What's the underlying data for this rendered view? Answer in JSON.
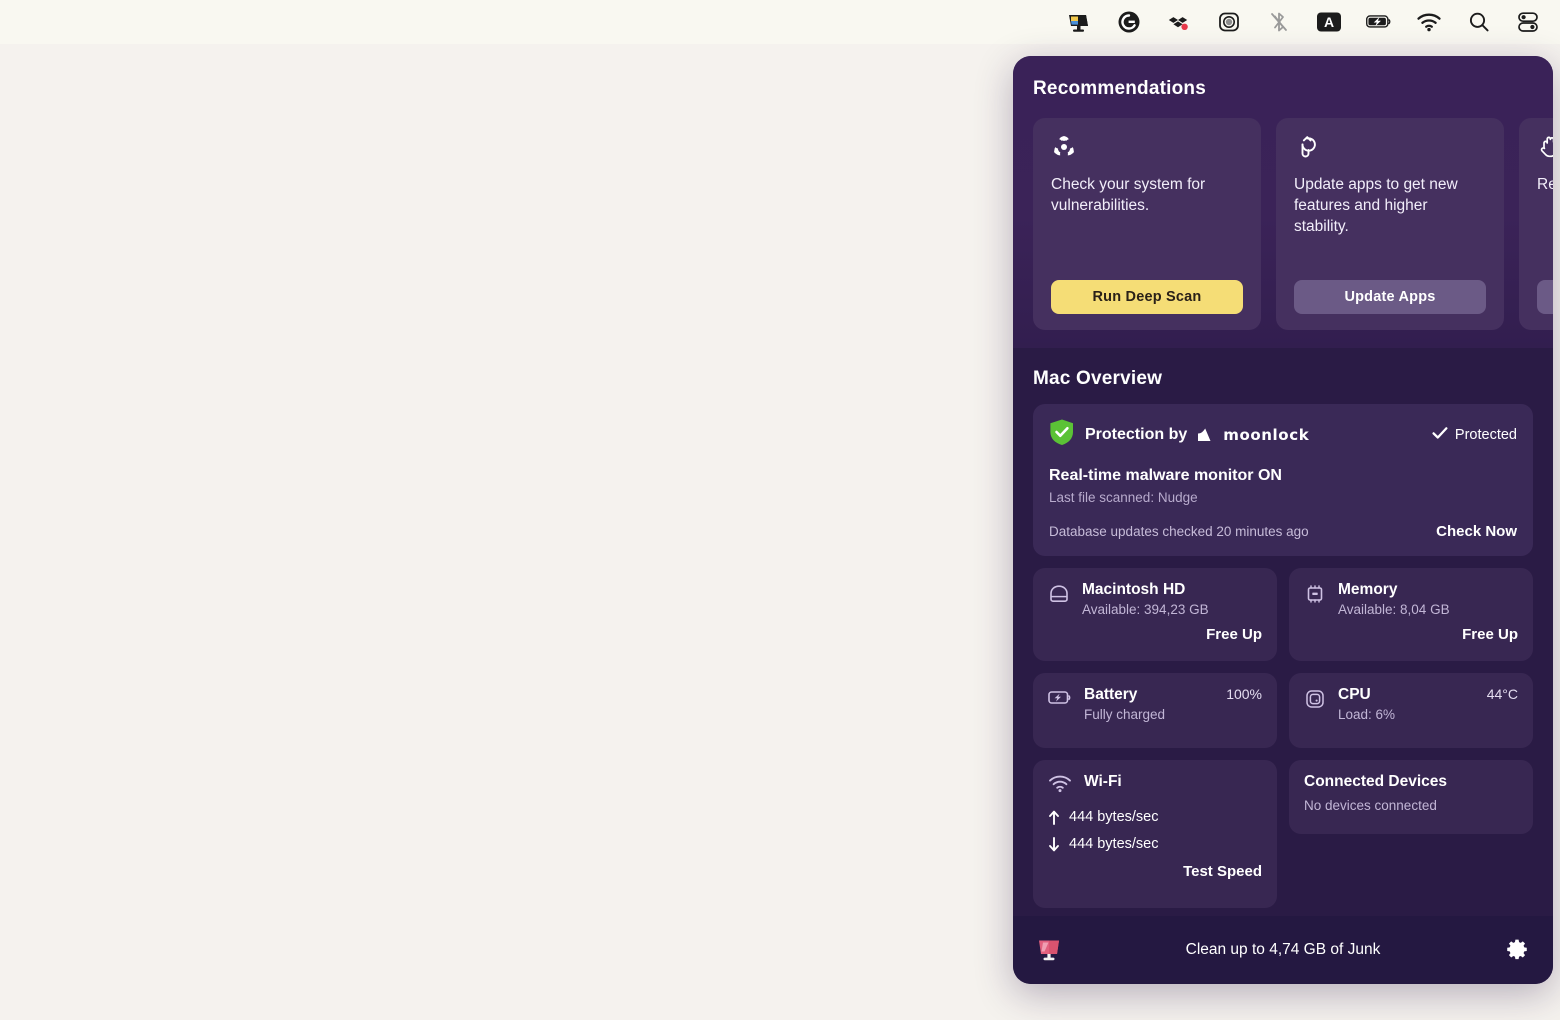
{
  "menubar": {
    "icons": [
      {
        "name": "cleanmymac-menu-icon",
        "label": "CleanMyMac"
      },
      {
        "name": "grammarly-icon",
        "label": "Grammarly"
      },
      {
        "name": "dropbox-icon",
        "label": "Dropbox"
      },
      {
        "name": "screen-recorder-icon",
        "label": "Screen Recorder"
      },
      {
        "name": "bluetooth-off-icon",
        "label": "Bluetooth Off"
      },
      {
        "name": "input-source-icon",
        "label": "A"
      },
      {
        "name": "battery-charging-icon",
        "label": "Battery Charging"
      },
      {
        "name": "wifi-icon",
        "label": "Wi-Fi"
      },
      {
        "name": "spotlight-search-icon",
        "label": "Spotlight Search"
      },
      {
        "name": "control-center-icon",
        "label": "Control Center"
      }
    ]
  },
  "panel": {
    "recommendations": {
      "title": "Recommendations",
      "cards": [
        {
          "icon": "biohazard-icon",
          "text": "Check your system for vulnerabilities.",
          "button": "Run Deep Scan",
          "button_style": "primary"
        },
        {
          "icon": "app-update-icon",
          "text": "Update apps to get new features and higher stability.",
          "button": "Update Apps",
          "button_style": "secondary"
        },
        {
          "icon": "hand-stop-icon",
          "text": "Rev allo trac",
          "button": "",
          "button_style": "secondary"
        }
      ]
    },
    "overview": {
      "title": "Mac Overview",
      "protection": {
        "shield_icon": "shield-check-icon",
        "label": "Protection by",
        "brand": "moonlock",
        "status": "Protected",
        "status_icon": "checkmark-icon",
        "monitor": "Real-time malware monitor ON",
        "last_file": "Last file scanned: Nudge",
        "database": "Database updates checked 20 minutes ago",
        "check_now": "Check Now"
      },
      "tiles": {
        "storage": {
          "icon": "hard-drive-icon",
          "name": "Macintosh HD",
          "sub": "Available: 394,23 GB",
          "action": "Free Up"
        },
        "memory": {
          "icon": "memory-chip-icon",
          "name": "Memory",
          "sub": "Available: 8,04 GB",
          "action": "Free Up"
        },
        "battery": {
          "icon": "battery-charging-icon",
          "name": "Battery",
          "sub": "Fully charged",
          "value": "100%"
        },
        "cpu": {
          "icon": "cpu-icon",
          "name": "CPU",
          "sub": "Load: 6%",
          "value": "44°C"
        },
        "wifi": {
          "icon": "wifi-icon",
          "name": "Wi-Fi",
          "upload": "444 bytes/sec",
          "download": "444 bytes/sec",
          "action": "Test Speed"
        },
        "devices": {
          "name": "Connected Devices",
          "sub": "No devices connected"
        }
      }
    },
    "footer": {
      "app_icon": "cleanmymac-icon",
      "text": "Clean up to 4,74 GB of Junk",
      "settings_icon": "gear-icon"
    }
  },
  "colors": {
    "desktop": "#f5f2ee",
    "menubar": "#f9f8f1",
    "panel_bg": "#2a1b45",
    "rec_bg": "#3b2358",
    "card_bg": "#45305f",
    "tile_bg": "#382752",
    "accent_yellow": "#f5dd76",
    "secondary_btn": "#6b5a86",
    "shield_green": "#5bc236",
    "footer_bg": "#241841"
  }
}
